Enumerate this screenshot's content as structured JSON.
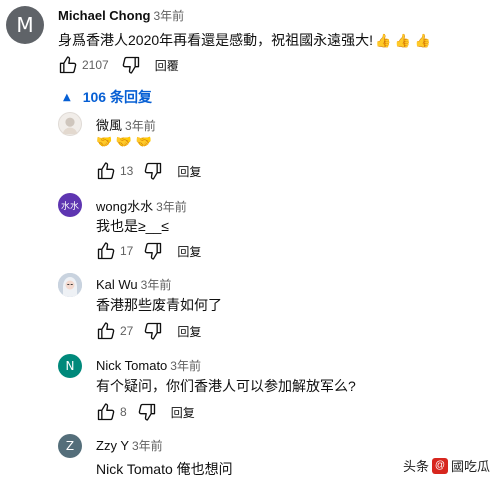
{
  "comments": [
    {
      "avatar_letter": "M",
      "author": "Michael Chong",
      "time": "3年前",
      "text": "身爲香港人2020年再看還是感動，祝祖國永遠强大!",
      "emoji": "👍 👍 👍",
      "likes": "2107",
      "reply_label": "回覆"
    },
    {
      "author": "微風",
      "time": "3年前",
      "emoji": "🤝 🤝 🤝",
      "likes": "13",
      "reply_label": "回复"
    },
    {
      "avatar_text": "水水",
      "author": "wong水水",
      "time": "3年前",
      "text": "我也是≥__≤",
      "likes": "17",
      "reply_label": "回复"
    },
    {
      "author": "Kal Wu",
      "time": "3年前",
      "text": "香港那些废青如何了",
      "likes": "27",
      "reply_label": "回复"
    },
    {
      "avatar_letter": "N",
      "author": "Nick Tomato",
      "time": "3年前",
      "text": "有个疑问，你们香港人可以参加解放军么?",
      "likes": "8",
      "reply_label": "回复"
    },
    {
      "avatar_letter": "Z",
      "author": "Zzy Y",
      "time": "3年前",
      "text": "Nick Tomato 俺也想问"
    }
  ],
  "replies_toggle": {
    "label": "106 条回复"
  },
  "watermark": {
    "prefix": "头条",
    "at": "@",
    "name": "國吃瓜"
  },
  "colors": {
    "link_blue": "#065fd4",
    "avatar_m": "#5f6368",
    "avatar_wong": "#5e35b1",
    "avatar_n": "#00897b",
    "avatar_z": "#546e7a",
    "watermark_red": "#d7261e"
  }
}
